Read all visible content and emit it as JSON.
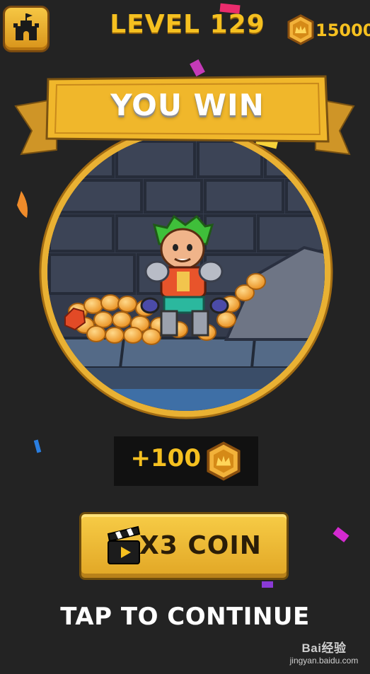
{
  "header": {
    "level_label": "LEVEL 129",
    "coin_count": "15000",
    "home_icon": "castle-icon"
  },
  "banner": {
    "title": "YOU WIN"
  },
  "reward": {
    "amount_label": "+100",
    "coin_icon": "crown-coin-icon"
  },
  "multiplier_button": {
    "label": "X3 COIN",
    "icon": "video-clapper-icon"
  },
  "continue_prompt": "TAP TO CONTINUE",
  "watermark": {
    "brand": "Bai经验",
    "url": "jingyan.baidu.com"
  },
  "colors": {
    "background": "#232323",
    "gold": "#f5c020",
    "banner_gold": "#f0b72b",
    "ring_gold": "#e9b133",
    "button_dark_text": "#2a1d08",
    "white": "#ffffff"
  }
}
